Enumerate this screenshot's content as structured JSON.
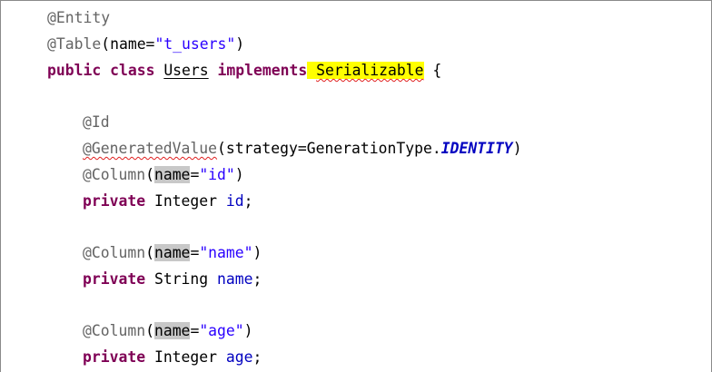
{
  "editor": {
    "lines": [
      {
        "tokens": [
          "@Entity"
        ]
      },
      {
        "tokens": [
          "@Table",
          "(name=",
          "\"t_users\"",
          ")"
        ]
      },
      {
        "tokens": [
          "public",
          " ",
          "class",
          " ",
          "Users",
          " ",
          "implements",
          " ",
          "Serializable",
          " {"
        ]
      },
      {
        "tokens": []
      },
      {
        "tokens": [
          "@Id"
        ]
      },
      {
        "tokens": [
          "@GeneratedValue",
          "(strategy=GenerationType.",
          "IDENTITY",
          ")"
        ]
      },
      {
        "tokens": [
          "@Column",
          "(",
          "name",
          "=",
          "\"id\"",
          ")"
        ]
      },
      {
        "tokens": [
          "private",
          " Integer ",
          "id",
          ";"
        ]
      },
      {
        "tokens": []
      },
      {
        "tokens": [
          "@Column",
          "(",
          "name",
          "=",
          "\"name\"",
          ")"
        ]
      },
      {
        "tokens": [
          "private",
          " String ",
          "name",
          ";"
        ]
      },
      {
        "tokens": []
      },
      {
        "tokens": [
          "@Column",
          "(",
          "name",
          "=",
          "\"age\"",
          ")"
        ]
      },
      {
        "tokens": [
          "private",
          " Integer ",
          "age",
          ";"
        ]
      }
    ]
  },
  "colors": {
    "annotation": "#646464",
    "keyword": "#7f0055",
    "string": "#2a00ff",
    "field": "#0000c0",
    "occurrence_highlight": "#c8c8c8",
    "search_highlight": "#ffff00",
    "spelling_error": "#e02020"
  }
}
